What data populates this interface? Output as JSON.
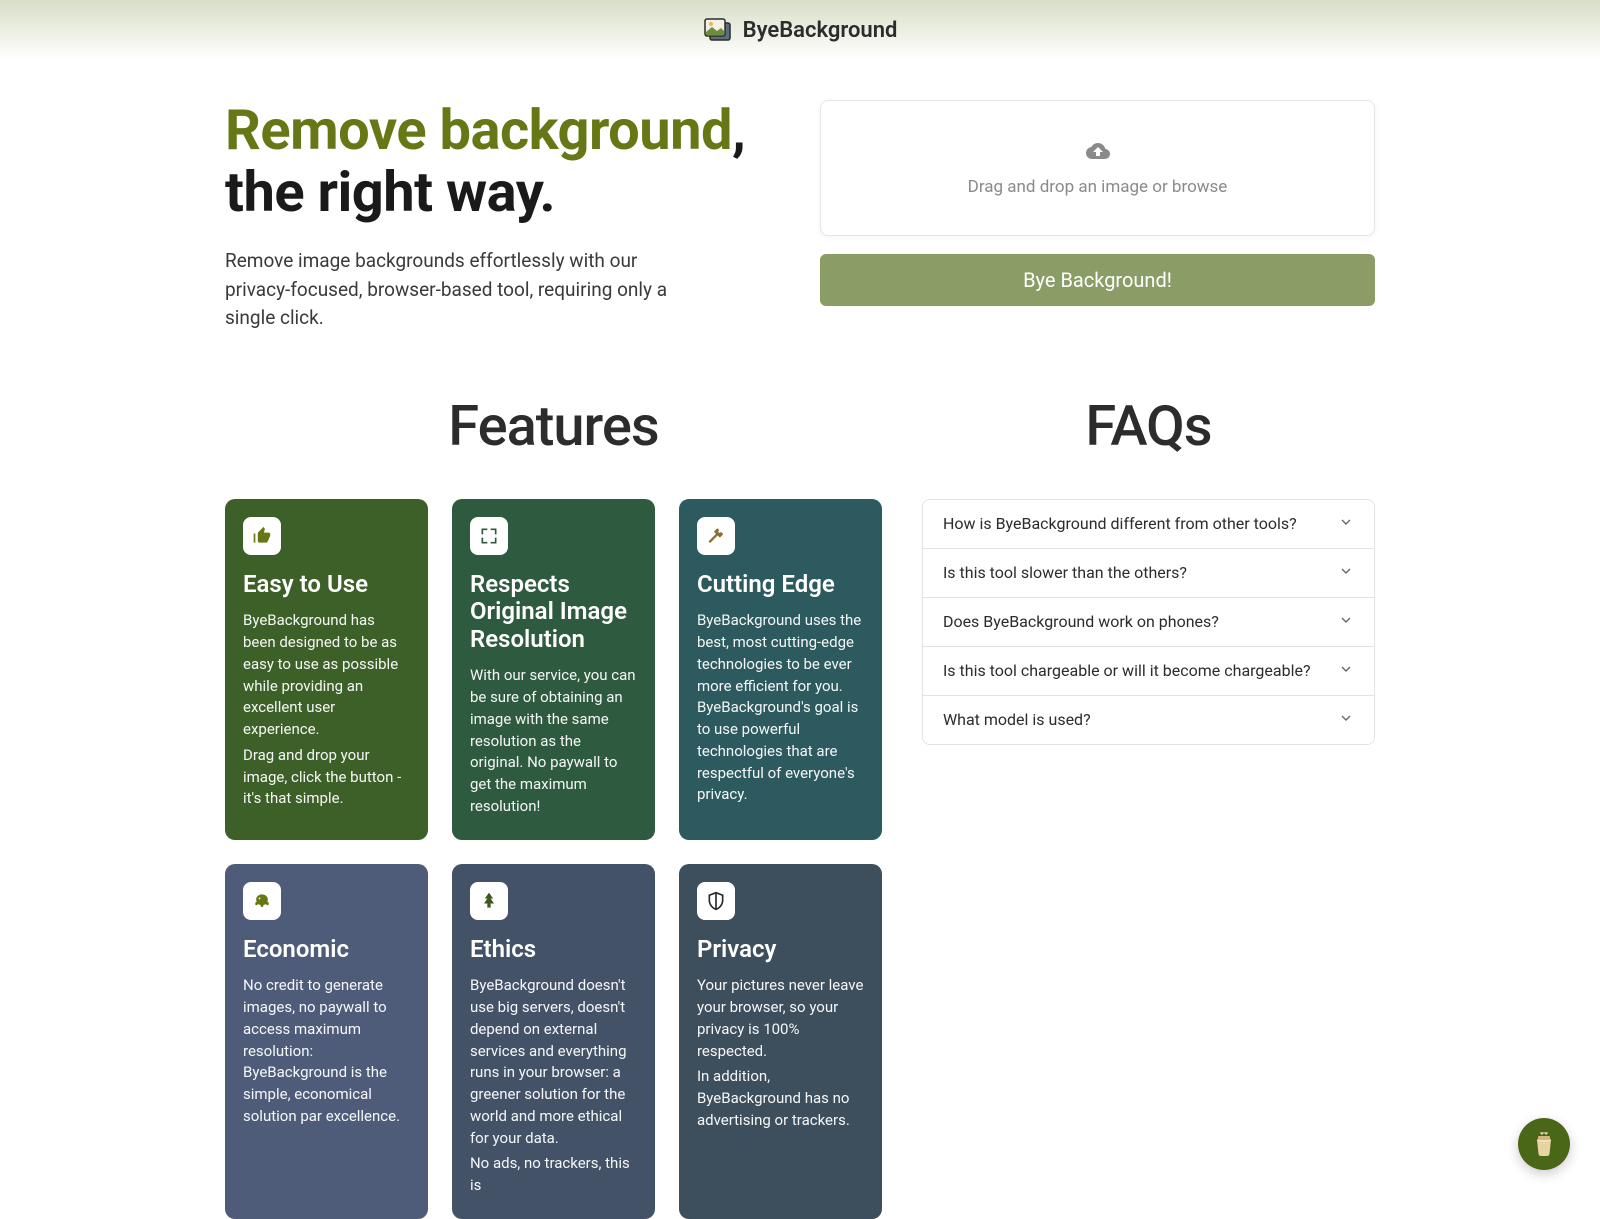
{
  "brand": {
    "name": "ByeBackground"
  },
  "hero": {
    "title_accent": "Remove background",
    "title_rest_line1": ",",
    "title_line2": "the right way.",
    "subtitle": "Remove image backgrounds effortlessly with our privacy-focused, browser-based tool, requiring only a single click."
  },
  "upload": {
    "dropzone_text": "Drag and drop an image or browse",
    "button_label": "Bye Background!"
  },
  "sections": {
    "features_title": "Features",
    "faqs_title": "FAQs"
  },
  "features": [
    {
      "title": "Easy to Use",
      "body1": "ByeBackground has been designed to be as easy to use as possible while providing an excellent user experience.",
      "body2": "Drag and drop your image, click the button - it's that simple."
    },
    {
      "title": "Respects Original Image Resolution",
      "body1": "With our service, you can be sure of obtaining an image with the same resolution as the original. No paywall to get the maximum resolution!",
      "body2": ""
    },
    {
      "title": "Cutting Edge",
      "body1": "ByeBackground uses the best, most cutting-edge technologies to be ever more efficient for you. ByeBackground's goal is to use powerful technologies that are respectful of everyone's privacy.",
      "body2": ""
    },
    {
      "title": "Economic",
      "body1": "No credit to generate images, no paywall to access maximum resolution: ByeBackground is the simple, economical solution par excellence.",
      "body2": ""
    },
    {
      "title": "Ethics",
      "body1": "ByeBackground doesn't use big servers, doesn't depend on external services and everything runs in your browser: a greener solution for the world and more ethical for your data.",
      "body2": "No ads, no trackers, this is"
    },
    {
      "title": "Privacy",
      "body1": "Your pictures never leave your browser, so your privacy is 100% respected.",
      "body2": "In addition, ByeBackground has no advertising or trackers."
    }
  ],
  "faqs": [
    {
      "q": "How is ByeBackground different from other tools?"
    },
    {
      "q": "Is this tool slower than the others?"
    },
    {
      "q": "Does ByeBackground work on phones?"
    },
    {
      "q": "Is this tool chargeable or will it become chargeable?"
    },
    {
      "q": "What model is used?"
    }
  ]
}
